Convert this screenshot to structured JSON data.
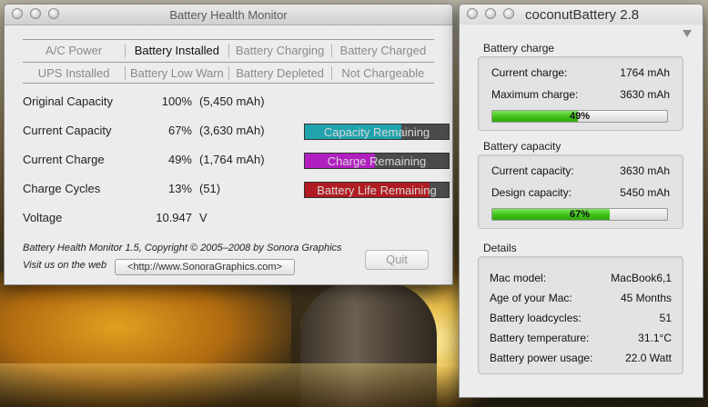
{
  "battery_health_monitor": {
    "window_title": "Battery Health Monitor",
    "status_rows": [
      [
        {
          "label": "A/C Power",
          "active": false
        },
        {
          "label": "Battery Installed",
          "active": true
        },
        {
          "label": "Battery Charging",
          "active": false
        },
        {
          "label": "Battery Charged",
          "active": false
        }
      ],
      [
        {
          "label": "UPS Installed",
          "active": false
        },
        {
          "label": "Battery Low Warn",
          "active": false
        },
        {
          "label": "Battery Depleted",
          "active": false
        },
        {
          "label": "Not Chargeable",
          "active": false
        }
      ]
    ],
    "metrics": {
      "original_capacity": {
        "label": "Original Capacity",
        "percent": "100%",
        "detail": "(5,450 mAh)"
      },
      "current_capacity": {
        "label": "Current Capacity",
        "percent": "67%",
        "detail": "(3,630 mAh)",
        "bar_label": "Capacity Remaining",
        "bar_fraction": 0.67,
        "bar_color": "#1fa3ad"
      },
      "current_charge": {
        "label": "Current Charge",
        "percent": "49%",
        "detail": "(1,764 mAh)",
        "bar_label": "Charge Remaining",
        "bar_fraction": 0.49,
        "bar_color": "#b21fc0"
      },
      "charge_cycles": {
        "label": "Charge Cycles",
        "percent": "13%",
        "detail": "(51)",
        "bar_label": "Battery Life Remaining",
        "bar_fraction": 0.87,
        "bar_color": "#b01c22"
      },
      "voltage": {
        "label": "Voltage",
        "value": "10.947",
        "unit": "V"
      }
    },
    "footer": {
      "copyright": "Battery Health Monitor 1.5, Copyright © 2005–2008 by Sonora Graphics",
      "visit_label": "Visit us on the web",
      "url_button": "<http://www.SonoraGraphics.com>",
      "quit_button": "Quit"
    }
  },
  "coconut_battery": {
    "window_title": "coconutBattery 2.8",
    "battery_charge": {
      "heading": "Battery charge",
      "current_label": "Current charge:",
      "current_value": "1764 mAh",
      "max_label": "Maximum charge:",
      "max_value": "3630 mAh",
      "bar_text": "49%",
      "bar_fraction": 0.49
    },
    "battery_capacity": {
      "heading": "Battery capacity",
      "current_label": "Current capacity:",
      "current_value": "3630 mAh",
      "design_label": "Design capacity:",
      "design_value": "5450 mAh",
      "bar_text": "67%",
      "bar_fraction": 0.67
    },
    "details": {
      "heading": "Details",
      "rows": [
        {
          "label": "Mac model:",
          "value": "MacBook6,1"
        },
        {
          "label": "Age of your Mac:",
          "value": "45 Months"
        },
        {
          "label": "Battery loadcycles:",
          "value": "51"
        },
        {
          "label": "Battery temperature:",
          "value": "31.1°C"
        },
        {
          "label": "Battery power usage:",
          "value": "22.0 Watt"
        }
      ]
    }
  }
}
